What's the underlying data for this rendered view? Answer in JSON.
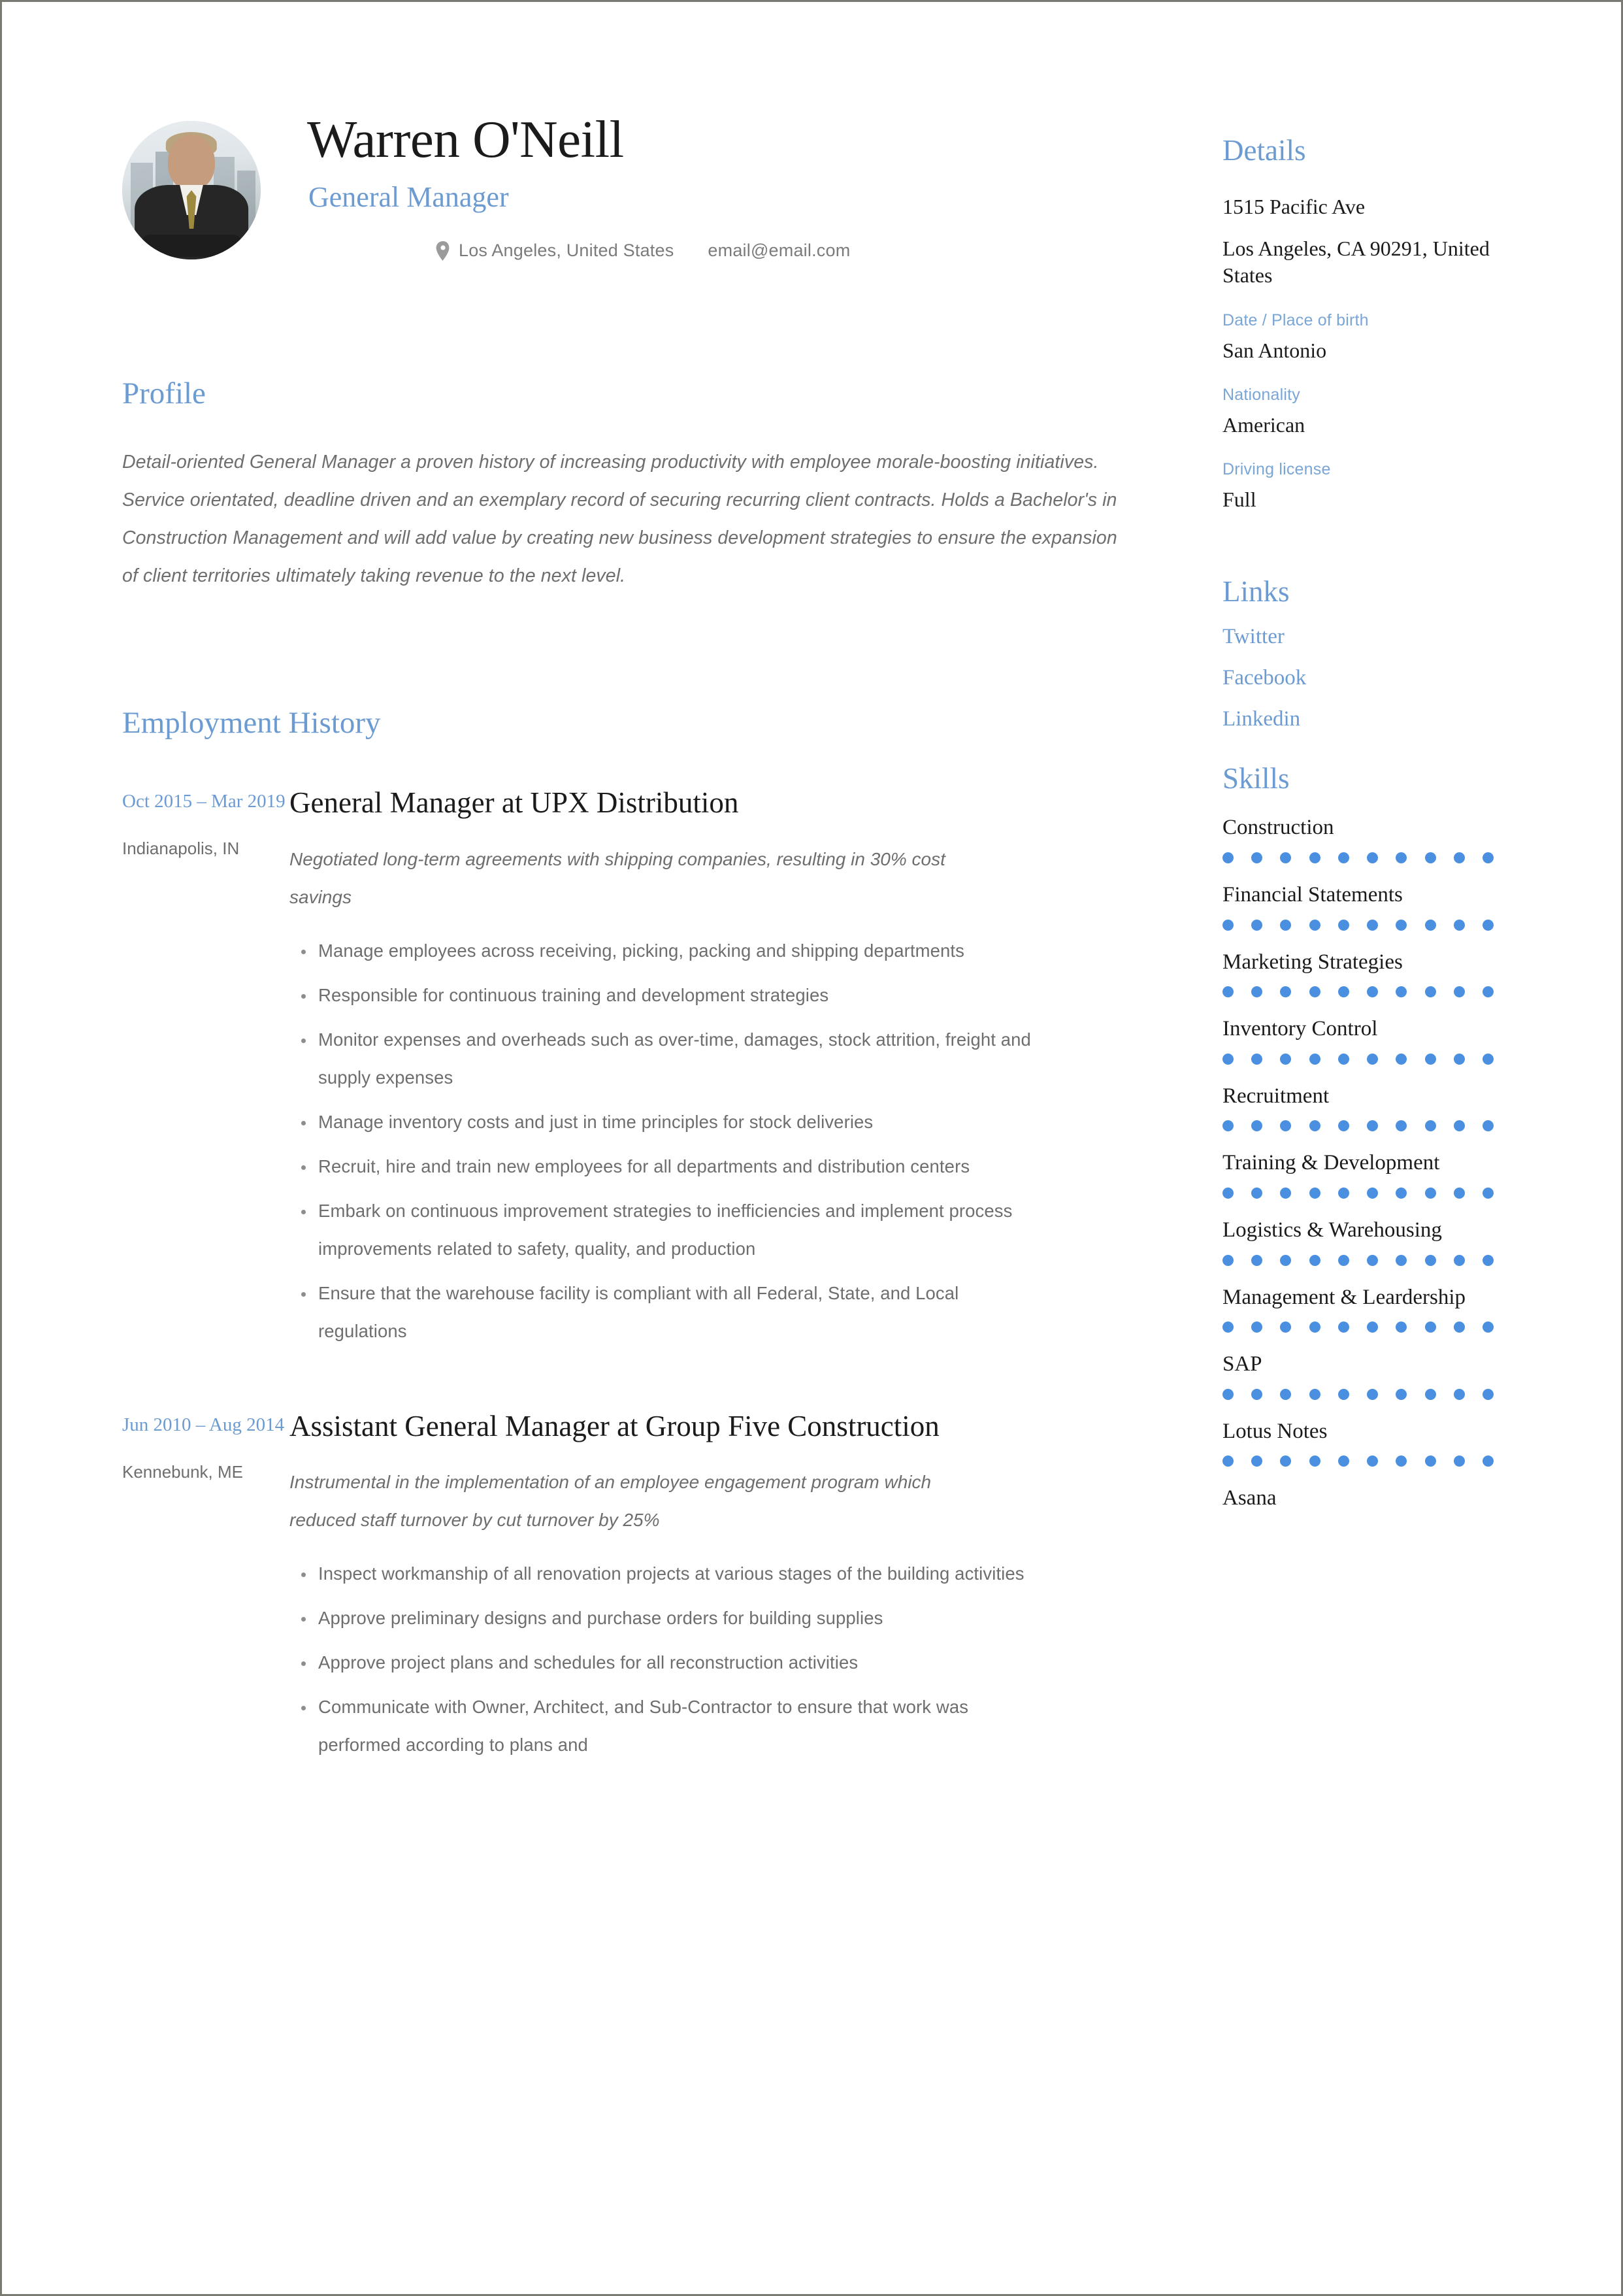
{
  "theme": {
    "accent_blue": "#6c9bd2",
    "dot_blue": "#4a8fe0",
    "body_gray": "#6e6e6e",
    "heading_dark": "#1b1b1b"
  },
  "header": {
    "name": "Warren O'Neill",
    "job_title": "General Manager",
    "location": "Los Angeles, United States",
    "email": "email@email.com",
    "location_icon": "map-pin-icon",
    "avatar_alt": "portrait of man in dark suit with city background"
  },
  "profile": {
    "heading": "Profile",
    "text": "Detail-oriented General Manager a proven history of increasing productivity with employee morale-boosting initiatives. Service orientated, deadline driven and an exemplary record of securing recurring client contracts. Holds a Bachelor's in Construction Management and will add value by creating new business development strategies to ensure the expansion of client territories ultimately taking revenue to the next level."
  },
  "employment": {
    "heading": "Employment History",
    "jobs": [
      {
        "dates": "Oct 2015 – Mar 2019",
        "location": "Indianapolis, IN",
        "title": "General Manager at UPX Distribution",
        "description": "Negotiated long-term agreements with shipping companies, resulting in 30% cost savings",
        "bullets": [
          "Manage employees across receiving, picking, packing and shipping departments",
          "Responsible for continuous training and development strategies",
          "Monitor expenses and overheads such as over-time, damages, stock attrition, freight and supply expenses",
          "Manage inventory costs and just in time principles for stock deliveries",
          "Recruit, hire and train new employees for all departments and distribution centers",
          "Embark on continuous improvement strategies to inefficiencies and implement process improvements related to safety, quality, and production",
          "Ensure that the warehouse facility is compliant with all Federal, State, and Local regulations"
        ]
      },
      {
        "dates": "Jun 2010 – Aug 2014",
        "location": "Kennebunk, ME",
        "title": "Assistant General Manager at Group Five Construction",
        "description": "Instrumental in the implementation of an employee engagement program which reduced staff turnover by cut turnover by 25%",
        "bullets": [
          "Inspect workmanship of all renovation projects at various stages of the building activities",
          "Approve preliminary designs and purchase orders for building supplies",
          "Approve project plans and schedules for all reconstruction activities",
          "Communicate with Owner, Architect, and Sub-Contractor to ensure that work was performed according to plans and"
        ]
      }
    ]
  },
  "details": {
    "heading": "Details",
    "address_line1": "1515 Pacific Ave",
    "address_line2": "Los Angeles, CA 90291, United States",
    "fields": [
      {
        "label": "Date / Place of birth",
        "value": "San Antonio"
      },
      {
        "label": "Nationality",
        "value": "American"
      },
      {
        "label": "Driving license",
        "value": "Full"
      }
    ]
  },
  "links": {
    "heading": "Links",
    "items": [
      {
        "label": "Twitter"
      },
      {
        "label": "Facebook"
      },
      {
        "label": "Linkedin"
      }
    ]
  },
  "skills": {
    "heading": "Skills",
    "dot_total": 10,
    "items": [
      {
        "name": "Construction",
        "level": 10
      },
      {
        "name": "Financial Statements",
        "level": 10
      },
      {
        "name": "Marketing Strategies",
        "level": 10
      },
      {
        "name": "Inventory Control",
        "level": 10
      },
      {
        "name": "Recruitment",
        "level": 10
      },
      {
        "name": "Training & Development",
        "level": 10
      },
      {
        "name": "Logistics & Warehousing",
        "level": 10
      },
      {
        "name": "Management & Leardership",
        "level": 10
      },
      {
        "name": "SAP",
        "level": 10
      },
      {
        "name": "Lotus Notes",
        "level": 10
      },
      {
        "name": "Asana",
        "level": 0
      }
    ]
  }
}
